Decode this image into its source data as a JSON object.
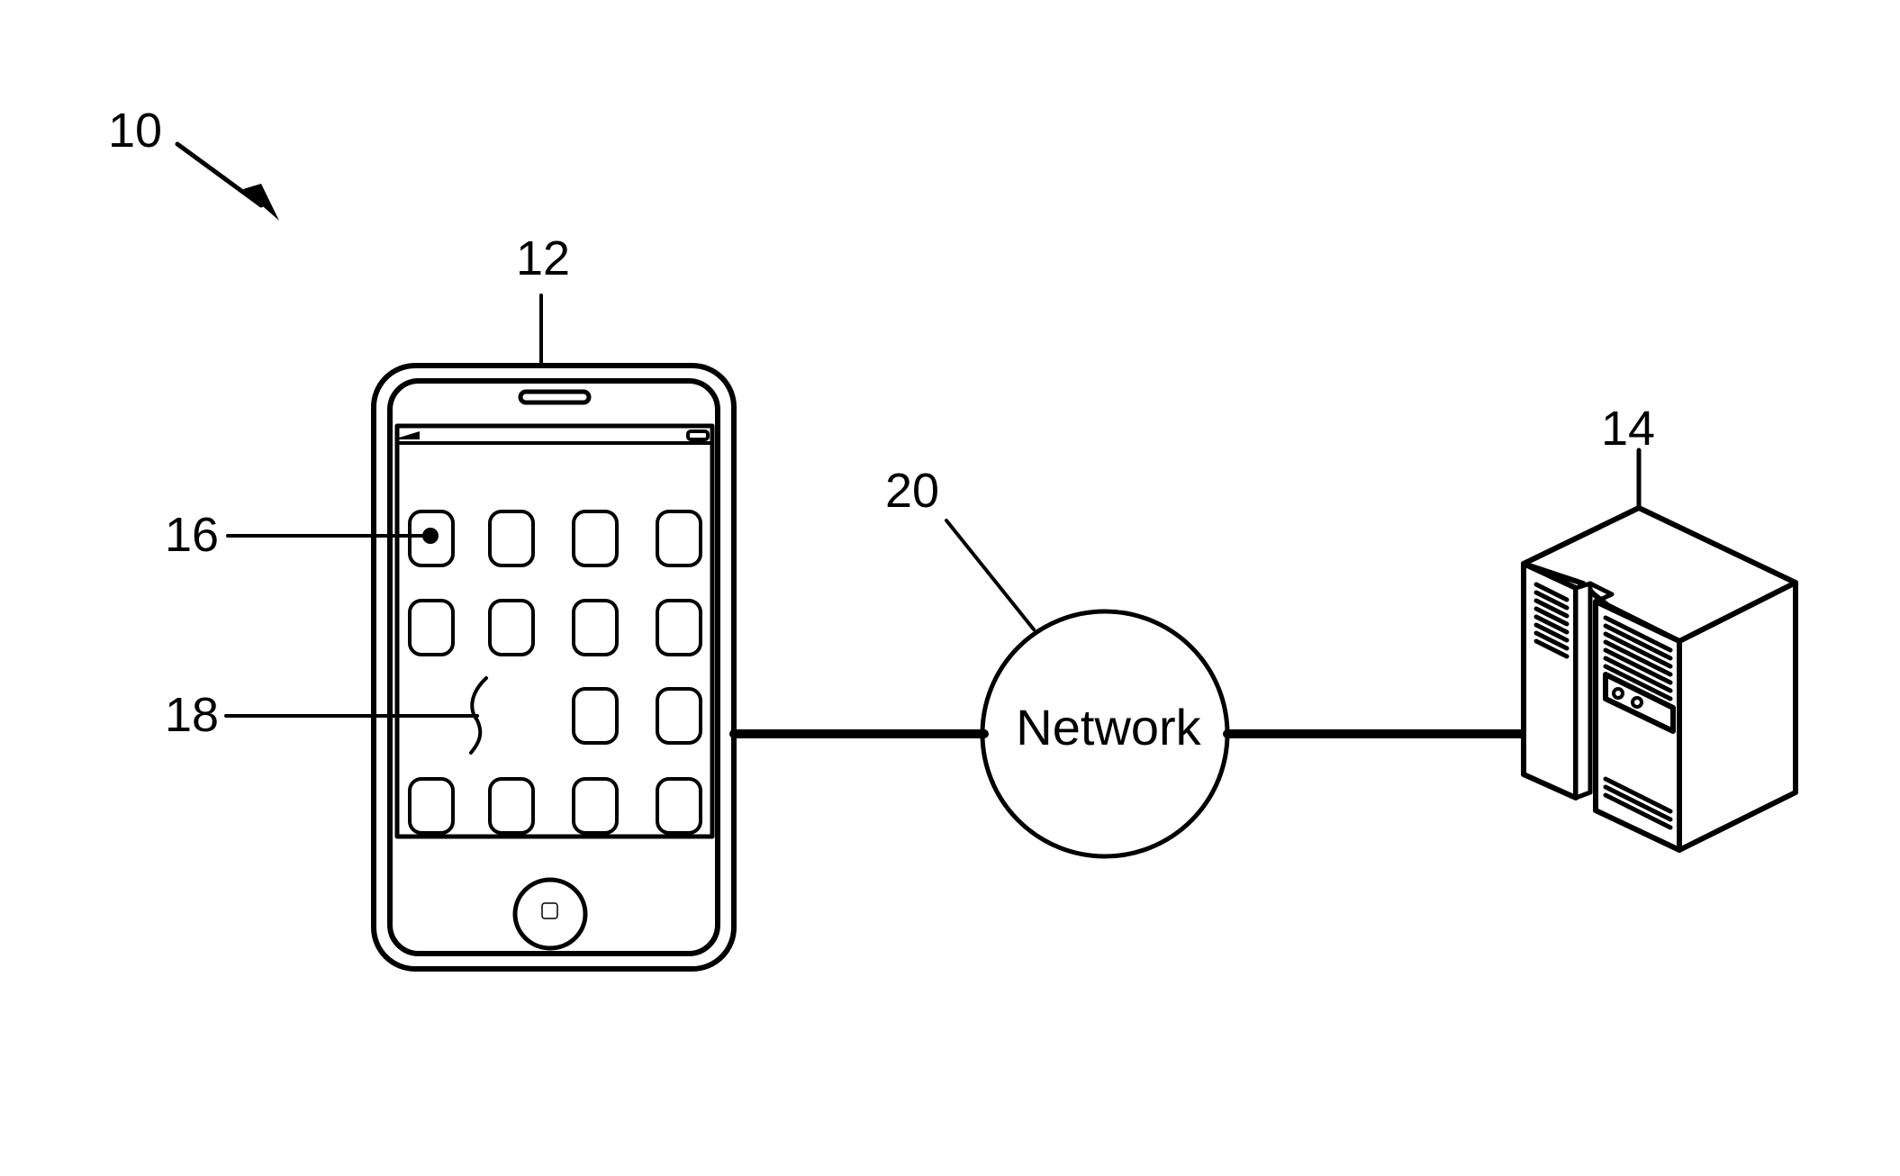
{
  "figure": {
    "type": "system diagram",
    "colors": {
      "stroke": "#000000",
      "background": "#ffffff"
    }
  },
  "labels": {
    "system": "10",
    "mobile_device": "12",
    "server": "14",
    "app_icon": "16",
    "missing_icon_slot": "18",
    "network_ref": "20"
  },
  "network": {
    "text": "Network"
  },
  "phone": {
    "icon_grid": {
      "rows": 4,
      "columns": 4,
      "present": [
        [
          true,
          true,
          true,
          true
        ],
        [
          true,
          true,
          true,
          true
        ],
        [
          false,
          false,
          true,
          true
        ],
        [
          true,
          true,
          true,
          true
        ]
      ],
      "selected": [
        0,
        0
      ]
    }
  },
  "connections": [
    {
      "from": "mobile_device",
      "to": "network"
    },
    {
      "from": "network",
      "to": "server"
    }
  ]
}
